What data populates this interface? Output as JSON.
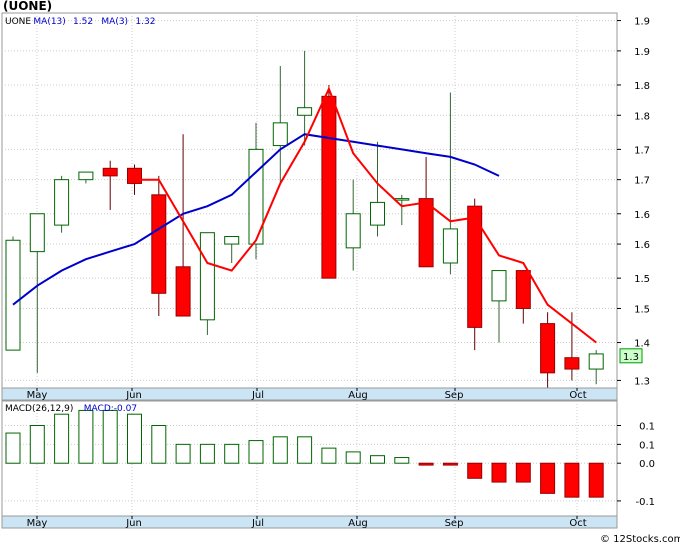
{
  "chart_data": [
    {
      "type": "candlestick",
      "title": "(UONE)",
      "legend": [
        {
          "text": "UONE",
          "color": "#000000"
        },
        {
          "text": "MA(13)",
          "color": "#0000cc"
        },
        {
          "text": "1.52",
          "color": "#0000cc"
        },
        {
          "text": "MA(3)",
          "color": "#0000cc"
        },
        {
          "text": "1.32",
          "color": "#0000cc"
        }
      ],
      "ylim": [
        1.28,
        1.99
      ],
      "y_ticks": [
        1.3,
        1.4,
        1.5,
        1.6,
        1.7,
        1.8,
        1.9
      ],
      "y_tick_labels": [
        "1.3",
        "1.4",
        "1.5",
        "1.6",
        "1.7",
        "1.7",
        "1.8",
        "1.8",
        "1.9",
        "1.9"
      ],
      "y_tick_values": [
        1.3,
        1.4,
        1.5,
        1.55,
        1.6,
        1.65,
        1.7,
        1.75,
        1.8,
        1.85,
        1.9
      ],
      "y_axis_labels": [
        {
          "value": 1.3,
          "text": "1.3"
        },
        {
          "value": 1.4,
          "text": "1.4"
        },
        {
          "value": 1.49,
          "text": "1.5"
        },
        {
          "value": 1.57,
          "text": "1.5"
        },
        {
          "value": 1.66,
          "text": "1.6"
        },
        {
          "value": 1.74,
          "text": "1.6"
        },
        {
          "value": 1.83,
          "text": "1.7"
        },
        {
          "value": 1.91,
          "text": "1.7"
        },
        {
          "value": 2.0,
          "text": "1.8"
        },
        {
          "value": 2.08,
          "text": "1.8"
        },
        {
          "value": 2.17,
          "text": "1.9"
        },
        {
          "value": 2.25,
          "text": "1.9"
        }
      ],
      "price_scale": {
        "min": 1.28,
        "max": 2.27
      },
      "candles": [
        {
          "o": 1.38,
          "h": 1.68,
          "l": 1.38,
          "c": 1.67
        },
        {
          "o": 1.64,
          "h": 1.74,
          "l": 1.32,
          "c": 1.74
        },
        {
          "o": 1.71,
          "h": 1.84,
          "l": 1.69,
          "c": 1.83
        },
        {
          "o": 1.83,
          "h": 1.85,
          "l": 1.82,
          "c": 1.85
        },
        {
          "o": 1.86,
          "h": 1.88,
          "l": 1.75,
          "c": 1.84
        },
        {
          "o": 1.86,
          "h": 1.87,
          "l": 1.79,
          "c": 1.82
        },
        {
          "o": 1.79,
          "h": 1.84,
          "l": 1.47,
          "c": 1.53
        },
        {
          "o": 1.6,
          "h": 1.95,
          "l": 1.49,
          "c": 1.47
        },
        {
          "o": 1.46,
          "h": 1.69,
          "l": 1.42,
          "c": 1.69
        },
        {
          "o": 1.66,
          "h": 1.68,
          "l": 1.61,
          "c": 1.68
        },
        {
          "o": 1.66,
          "h": 1.98,
          "l": 1.62,
          "c": 1.91
        },
        {
          "o": 1.92,
          "h": 2.13,
          "l": 1.82,
          "c": 1.98
        },
        {
          "o": 2.0,
          "h": 2.17,
          "l": 1.92,
          "c": 2.02
        },
        {
          "o": 2.05,
          "h": 2.08,
          "l": 1.58,
          "c": 1.57
        },
        {
          "o": 1.65,
          "h": 1.83,
          "l": 1.59,
          "c": 1.74
        },
        {
          "o": 1.71,
          "h": 1.93,
          "l": 1.68,
          "c": 1.77
        },
        {
          "o": 1.78,
          "h": 1.79,
          "l": 1.71,
          "c": 1.78
        },
        {
          "o": 1.78,
          "h": 1.89,
          "l": 1.6,
          "c": 1.6
        },
        {
          "o": 1.61,
          "h": 2.06,
          "l": 1.58,
          "c": 1.7
        },
        {
          "o": 1.76,
          "h": 1.78,
          "l": 1.38,
          "c": 1.44
        },
        {
          "o": 1.51,
          "h": 1.55,
          "l": 1.4,
          "c": 1.59
        },
        {
          "o": 1.59,
          "h": 1.55,
          "l": 1.45,
          "c": 1.49
        },
        {
          "o": 1.45,
          "h": 1.48,
          "l": 1.28,
          "c": 1.32
        },
        {
          "o": 1.36,
          "h": 1.48,
          "l": 1.3,
          "c": 1.33
        },
        {
          "o": 1.33,
          "h": 1.38,
          "l": 1.29,
          "c": 1.37
        }
      ],
      "ma13": [
        1.5,
        1.55,
        1.59,
        1.62,
        1.64,
        1.66,
        1.7,
        1.74,
        1.76,
        1.79,
        1.85,
        1.91,
        1.95,
        1.94,
        1.93,
        1.92,
        1.91,
        1.9,
        1.89,
        1.87,
        1.84
      ],
      "ma3": [
        1.83,
        1.83,
        1.72,
        1.61,
        1.59,
        1.67,
        1.82,
        1.93,
        2.07,
        1.9,
        1.82,
        1.76,
        1.77,
        1.72,
        1.73,
        1.63,
        1.61,
        1.5,
        1.45,
        1.4
      ],
      "last_price_label": "1.3",
      "x_labels": [
        "May",
        "Jun",
        "Jul",
        "Aug",
        "Sep",
        "Oct"
      ]
    },
    {
      "type": "bar",
      "legend": [
        {
          "text": "MACD(26,12,9)",
          "color": "#000000"
        },
        {
          "text": "MACD:-0.07",
          "color": "#0000cc"
        }
      ],
      "ylim": [
        -0.14,
        0.165
      ],
      "y_ticks": [
        -0.1,
        0.0,
        0.1,
        0.1
      ],
      "y_axis_labels": [
        {
          "value": -0.1,
          "text": "-0.1"
        },
        {
          "value": 0.0,
          "text": "0.0"
        },
        {
          "value": 0.05,
          "text": "0.1"
        },
        {
          "value": 0.1,
          "text": "0.1"
        }
      ],
      "values": [
        0.08,
        0.1,
        0.13,
        0.14,
        0.14,
        0.13,
        0.1,
        0.05,
        0.05,
        0.05,
        0.06,
        0.07,
        0.07,
        0.04,
        0.03,
        0.02,
        0.015,
        -0.005,
        -0.005,
        -0.04,
        -0.05,
        -0.05,
        -0.08,
        -0.09,
        -0.09
      ],
      "x_labels": [
        "May",
        "Jun",
        "Jul",
        "Aug",
        "Sep",
        "Oct"
      ]
    }
  ],
  "credit": "© 12Stocks.com"
}
